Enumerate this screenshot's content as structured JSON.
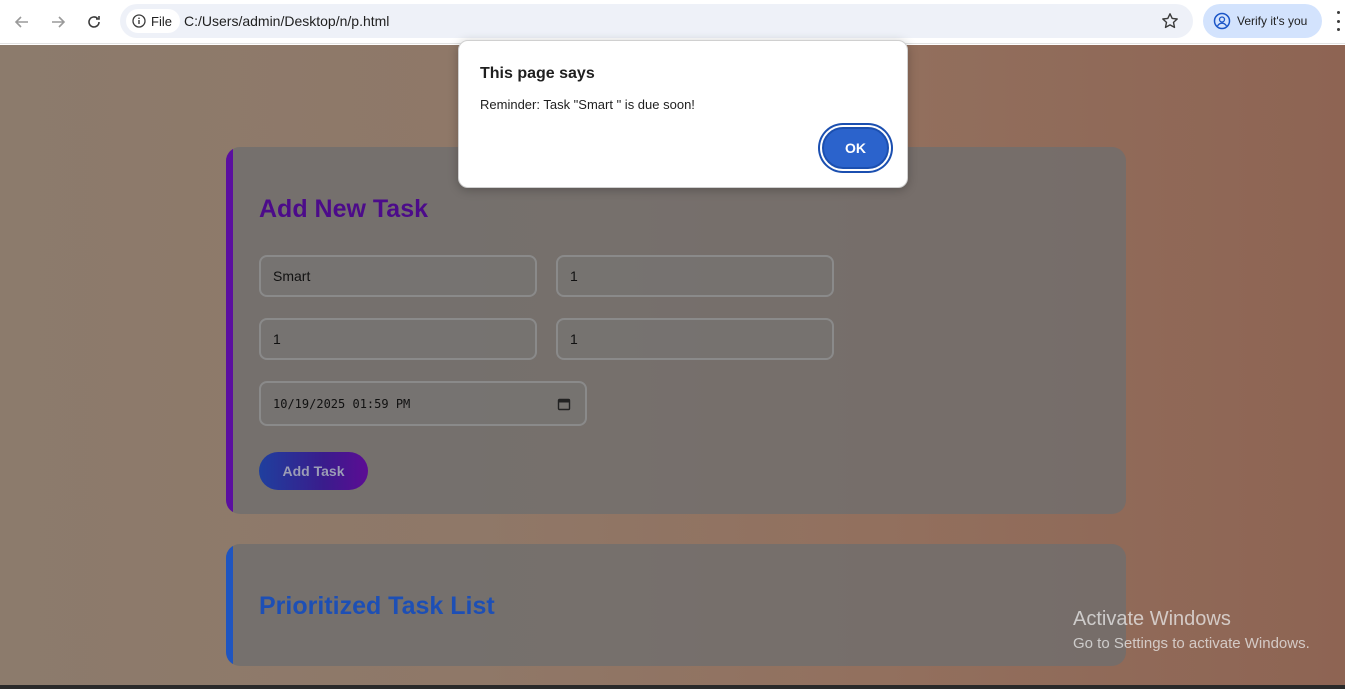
{
  "browser": {
    "file_label": "File",
    "url": "C:/Users/admin/Desktop/n/p.html",
    "verify_label": "Verify it's you"
  },
  "dialog": {
    "title": "This page says",
    "message": "Reminder: Task \"Smart \" is due soon!",
    "ok_label": "OK"
  },
  "add_task_card": {
    "title": "Add New Task",
    "fields": {
      "name": "Smart",
      "field2": "1",
      "field3": "1",
      "field4": "1",
      "due": "10/19/2025 01:59 PM"
    },
    "add_button": "Add Task"
  },
  "task_list_card": {
    "title": "Prioritized Task List"
  },
  "watermark": {
    "line1": "Activate Windows",
    "line2": "Go to Settings to activate Windows."
  },
  "colors": {
    "dialog_button": "#2b63cc",
    "add_card_accent": "#5b0fa0",
    "list_card_accent": "#1f55c0"
  }
}
